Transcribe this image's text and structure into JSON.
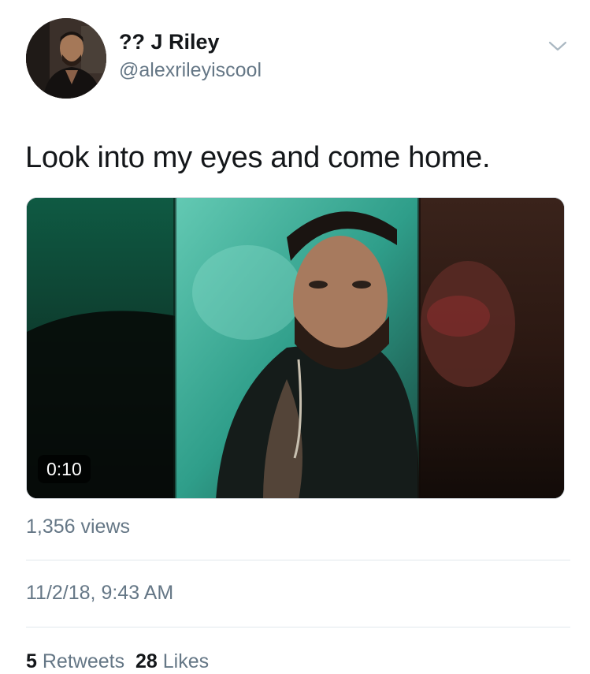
{
  "tweet": {
    "author": {
      "display_name": "?? J Riley",
      "handle": "@alexrileyiscool",
      "avatar_icon": "avatar-photo"
    },
    "menu_icon": "chevron-down-icon",
    "text": "Look into my eyes and come home.",
    "video": {
      "duration": "0:10"
    },
    "views": "1,356 views",
    "timestamp": "11/2/18, 9:43 AM",
    "stats": {
      "retweets_count": "5",
      "retweets_label": "Retweets",
      "likes_count": "28",
      "likes_label": "Likes"
    }
  },
  "colors": {
    "primary_text": "#14171a",
    "secondary_text": "#657786",
    "divider": "#e1e8ed"
  }
}
